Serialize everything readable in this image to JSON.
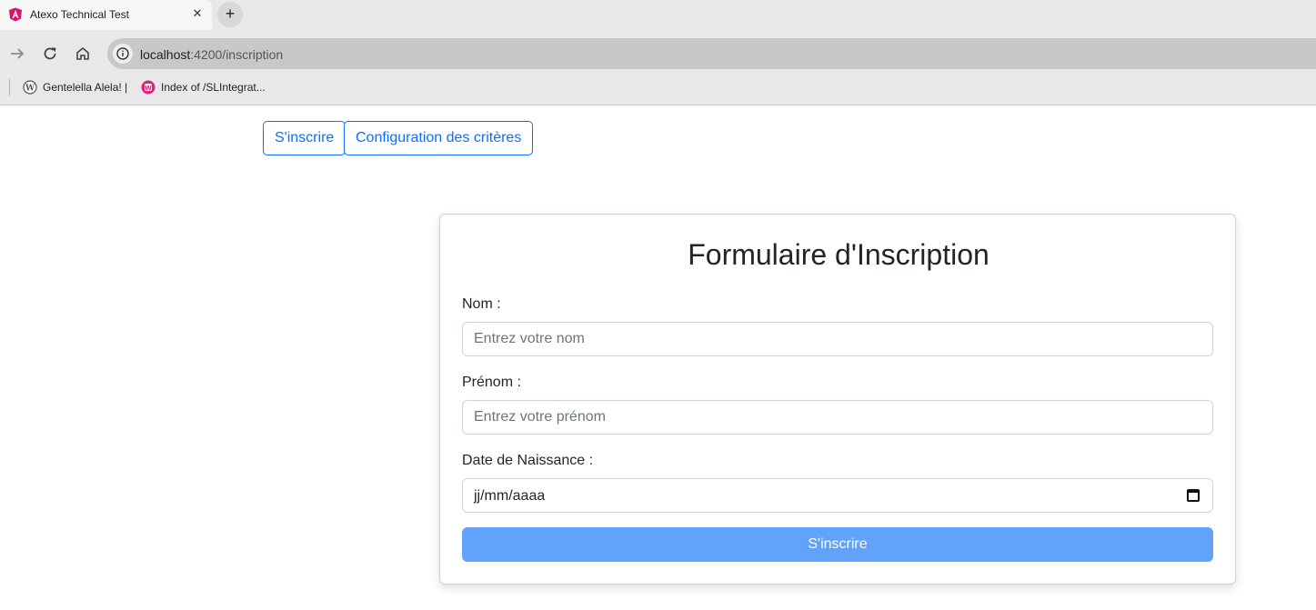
{
  "browser": {
    "tab_title": "Atexo Technical Test",
    "tab_close": "✕",
    "new_tab": "+",
    "url_host": "localhost",
    "url_rest": ":4200/inscription",
    "bookmarks": [
      {
        "label": "Gentelella Alela! |"
      },
      {
        "label": "Index of /SLIntegrat..."
      }
    ]
  },
  "nav": {
    "inscrire_label": "S'inscrire",
    "config_label": "Configuration des critères"
  },
  "form": {
    "title": "Formulaire d'Inscription",
    "nom_label": "Nom :",
    "nom_placeholder": "Entrez votre nom",
    "prenom_label": "Prénom :",
    "prenom_placeholder": "Entrez votre prénom",
    "date_label": "Date de Naissance :",
    "date_placeholder": "jj/mm/aaaa",
    "submit_label": "S'inscrire"
  },
  "colors": {
    "primary": "#0d6efd",
    "submit_disabled": "#60a2fc"
  }
}
